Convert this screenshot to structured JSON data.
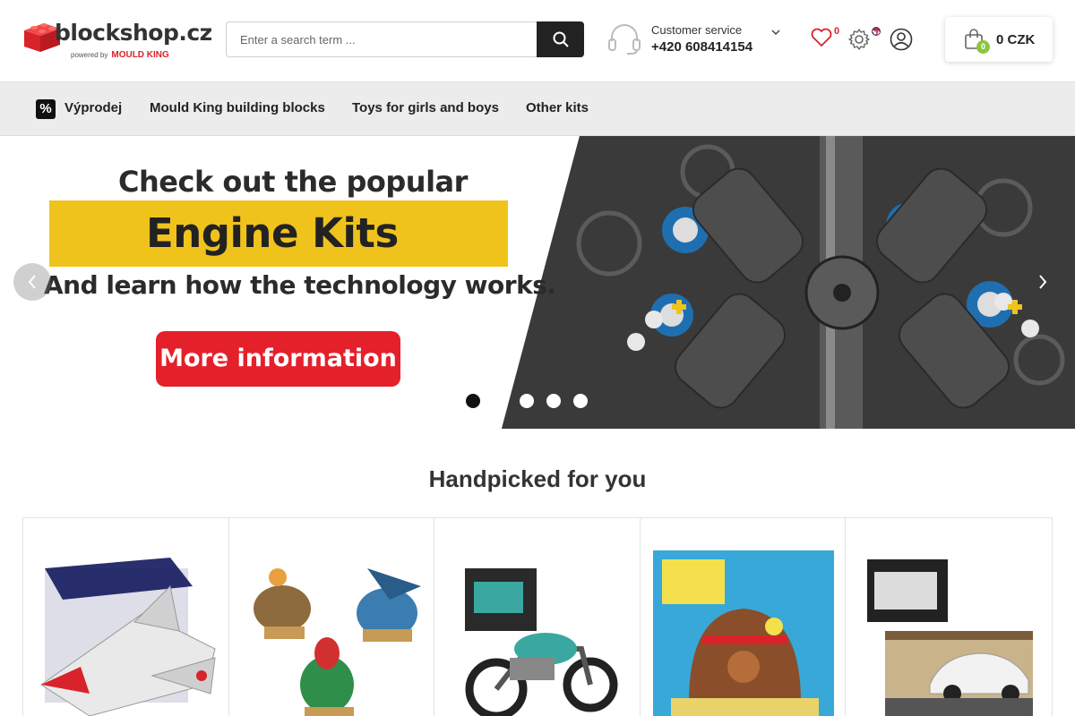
{
  "header": {
    "logo_text": "blockshop.cz",
    "logo_powered": "powered by",
    "logo_brand": "MOULD KING",
    "search_placeholder": "Enter a search term ...",
    "service_label": "Customer service",
    "service_phone": "+420 608414154",
    "wishlist_count": "0",
    "cart_count": "0",
    "cart_total": "0 CZK",
    "accent_color": "#d8232a"
  },
  "nav": {
    "items": [
      {
        "label": "Výprodej",
        "icon": "percent-icon"
      },
      {
        "label": "Mould King building blocks"
      },
      {
        "label": "Toys for girls and boys"
      },
      {
        "label": "Other kits"
      }
    ]
  },
  "banner": {
    "line1": "Check out the popular",
    "line2": "Engine Kits",
    "line3": "And learn how the technology works.",
    "cta": "More information",
    "slides": 5,
    "active_slide": 1
  },
  "section": {
    "title": "Handpicked for you"
  },
  "products": [
    {
      "image": "jet-fighter-kit"
    },
    {
      "image": "sea-creatures-kit"
    },
    {
      "image": "motorcycle-kit"
    },
    {
      "image": "spongebob-kit"
    },
    {
      "image": "sports-car-scene-kit"
    }
  ]
}
